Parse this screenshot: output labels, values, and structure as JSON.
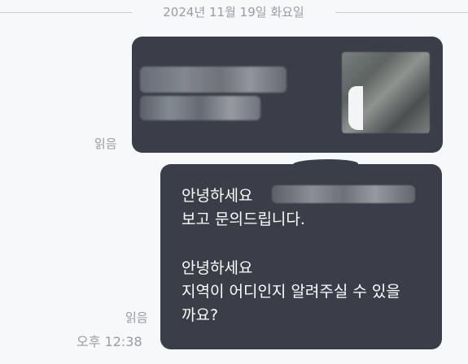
{
  "conversation": {
    "date_divider": "2024년 11월 19일 화요일",
    "messages": [
      {
        "id": "image-message",
        "read_status": "읽음",
        "content": {
          "redacted_text": true,
          "redacted_image": true
        }
      },
      {
        "id": "text-message",
        "read_status": "읽음",
        "time": "오후 12:38",
        "lines": [
          "안녕하세요",
          "보고 문의드립니다.",
          "",
          "안녕하세요",
          "지역이 어디인지 알려주실 수 있을",
          "까요?"
        ]
      }
    ]
  },
  "colors": {
    "background": "#f7f8fa",
    "bubble": "#393e48",
    "text_on_bubble": "#ffffff",
    "meta_text": "#979ca6"
  }
}
